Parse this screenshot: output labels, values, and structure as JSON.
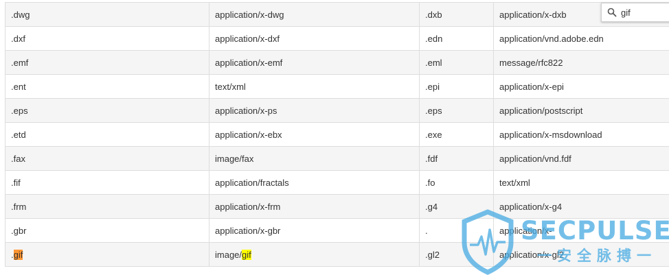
{
  "find_bar": {
    "query": "gif"
  },
  "table": {
    "rows": [
      {
        "ext1": ".dwg",
        "mime1": "application/x-dwg",
        "ext2": ".dxb",
        "mime2": "application/x-dxb"
      },
      {
        "ext1": ".dxf",
        "mime1": "application/x-dxf",
        "ext2": ".edn",
        "mime2": "application/vnd.adobe.edn"
      },
      {
        "ext1": ".emf",
        "mime1": "application/x-emf",
        "ext2": ".eml",
        "mime2": "message/rfc822"
      },
      {
        "ext1": ".ent",
        "mime1": "text/xml",
        "ext2": ".epi",
        "mime2": "application/x-epi"
      },
      {
        "ext1": ".eps",
        "mime1": "application/x-ps",
        "ext2": ".eps",
        "mime2": "application/postscript"
      },
      {
        "ext1": ".etd",
        "mime1": "application/x-ebx",
        "ext2": ".exe",
        "mime2": "application/x-msdownload"
      },
      {
        "ext1": ".fax",
        "mime1": "image/fax",
        "ext2": ".fdf",
        "mime2": "application/vnd.fdf"
      },
      {
        "ext1": ".fif",
        "mime1": "application/fractals",
        "ext2": ".fo",
        "mime2": "text/xml"
      },
      {
        "ext1": ".frm",
        "mime1": "application/x-frm",
        "ext2": ".g4",
        "mime2": "application/x-g4"
      },
      {
        "ext1": ".gbr",
        "mime1": "application/x-gbr",
        "ext2": ".",
        "mime2": "application/x-"
      },
      {
        "ext1_prefix": ".",
        "ext1_match": "gif",
        "mime1_prefix": "image/",
        "mime1_match": "gif",
        "ext2": ".gl2",
        "mime2": "application/x-gl2"
      }
    ]
  },
  "watermark": {
    "brand": "SECPULSE",
    "tagline": "一安全脉搏一"
  },
  "colors": {
    "active_match": "#ff9632",
    "other_match": "#ffff00",
    "row_shade": "#f5f5f5",
    "border": "#dddddd",
    "watermark": "#46aae1"
  }
}
